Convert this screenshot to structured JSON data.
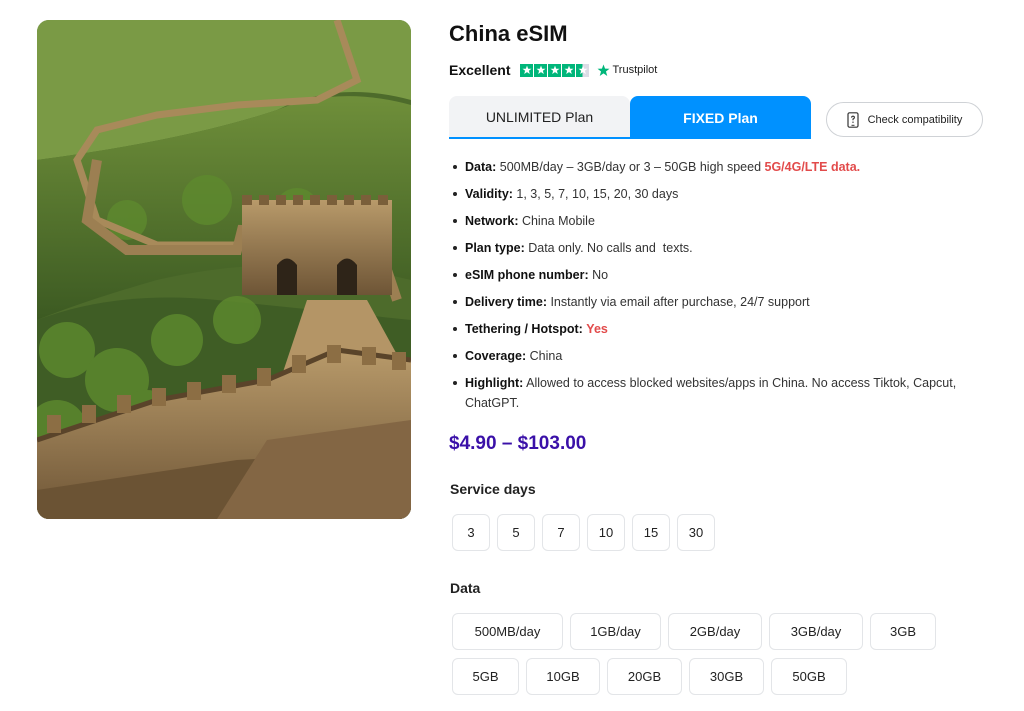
{
  "product": {
    "title": "China eSIM",
    "image_alt": "Great Wall of China"
  },
  "rating": {
    "label": "Excellent",
    "stars": 4.5,
    "provider": "Trustpilot",
    "star_color": "#00b67a"
  },
  "tabs": [
    {
      "label": "UNLIMITED Plan",
      "active": false
    },
    {
      "label": "FIXED Plan",
      "active": true
    }
  ],
  "compatibility_button": {
    "label": "Check compatibility",
    "icon": "phone-question-icon"
  },
  "features": [
    {
      "key": "Data:",
      "value": " 500MB/day – 3GB/day or 3 – 50GB high speed ",
      "highlight": "5G/4G/LTE data."
    },
    {
      "key": "Validity:",
      "value": " 1, 3, 5, 7, 10, 15, 20, 30 days"
    },
    {
      "key": "Network:",
      "value": " China Mobile"
    },
    {
      "key": "Plan type:",
      "value": " Data only. No calls and  texts."
    },
    {
      "key": "eSIM phone number:",
      "value": " No"
    },
    {
      "key": "Delivery time:",
      "value": " Instantly via email after purchase, 24/7 support"
    },
    {
      "key": "Tethering / Hotspot:",
      "value": " ",
      "highlight": "Yes"
    },
    {
      "key": "Coverage:",
      "value": " China"
    },
    {
      "key": "Highlight:",
      "value": " Allowed to access blocked websites/apps in China. No access Tiktok, Capcut, ChatGPT."
    }
  ],
  "price": "$4.90 – $103.00",
  "service_days": {
    "label": "Service days",
    "options": [
      "3",
      "5",
      "7",
      "10",
      "15",
      "30"
    ]
  },
  "data_options": {
    "label": "Data",
    "row1": [
      "500MB/day",
      "1GB/day",
      "2GB/day",
      "3GB/day",
      "3GB"
    ],
    "row2": [
      "5GB",
      "10GB",
      "20GB",
      "30GB",
      "50GB"
    ]
  },
  "colors": {
    "accent_blue": "#0091ff",
    "price_purple": "#3a10a8",
    "highlight_red": "#e24b4b"
  }
}
